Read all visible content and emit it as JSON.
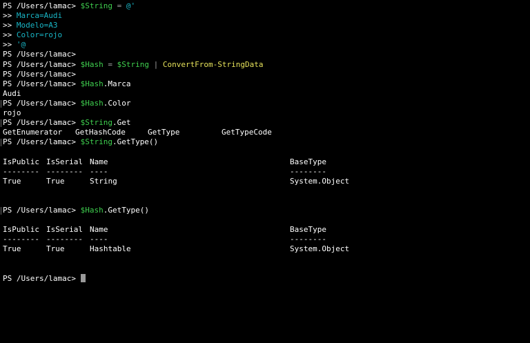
{
  "prompt": "PS /Users/lamac>",
  "commands": {
    "c1": {
      "var": "$String",
      "op": "=",
      "str": "@'"
    },
    "heredoc": [
      "Marca=Audi",
      "Modelo=A3",
      "Color=rojo",
      "'@"
    ],
    "continuation": ">>",
    "c2": {
      "var1": "$Hash",
      "op": "=",
      "var2": "$String",
      "pipe": "|",
      "cmd": "ConvertFrom-StringData"
    },
    "c3": {
      "var": "$Hash",
      "member": ".Marca"
    },
    "c4": {
      "var": "$Hash",
      "member": ".Color"
    },
    "c5": {
      "var": "$String",
      "member": ".Get"
    },
    "c6": {
      "var": "$String",
      "member": ".GetType()"
    },
    "c7": {
      "var": "$Hash",
      "member": ".GetType()"
    }
  },
  "outputs": {
    "marca": "Audi",
    "color": "rojo",
    "get_methods": [
      "GetEnumerator",
      "GetHashCode",
      "GetType",
      "GetTypeCode"
    ]
  },
  "type_table": {
    "headers": [
      "IsPublic",
      "IsSerial",
      "Name",
      "BaseType"
    ],
    "underlines": [
      "--------",
      "--------",
      "----",
      "--------"
    ],
    "string_row": [
      "True",
      "True",
      "String",
      "System.Object"
    ],
    "hash_row": [
      "True",
      "True",
      "Hashtable",
      "System.Object"
    ]
  },
  "colors": {
    "background": "#000000",
    "variable": "#3fd04f",
    "string_literal": "#19b6c6",
    "cmdlet": "#e5e15a",
    "operator": "#9e9e9e",
    "cursor": "#9a9a9a"
  }
}
